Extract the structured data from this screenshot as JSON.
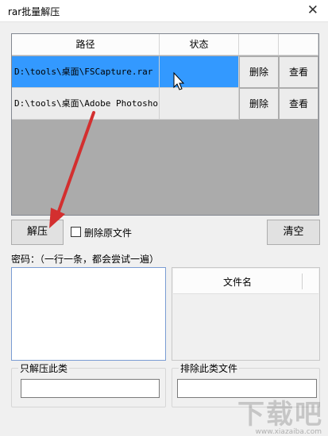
{
  "window": {
    "title": "rar批量解压",
    "close_glyph": "✕"
  },
  "grid": {
    "columns": [
      "路径",
      "状态",
      "",
      ""
    ],
    "rows": [
      {
        "path": "D:\\tools\\桌面\\FSCapture.rar",
        "status": "",
        "delete_label": "删除",
        "view_label": "查看",
        "selected": true
      },
      {
        "path": "D:\\tools\\桌面\\Adobe Photoshop",
        "status": "",
        "delete_label": "删除",
        "view_label": "查看",
        "selected": false
      }
    ]
  },
  "toolbar": {
    "extract_label": "解压",
    "delete_source_label": "删除原文件",
    "delete_source_checked": false,
    "clear_label": "清空"
  },
  "password": {
    "label": "密码：（一行一条，都会尝试一遍）",
    "value": ""
  },
  "filelist": {
    "header": "文件名"
  },
  "filters": {
    "only_extract_title": "只解压此类",
    "only_extract_value": "",
    "exclude_title": "排除此类文件",
    "exclude_value": ""
  },
  "watermark": {
    "text": "下载吧",
    "sub": "www.xiazaiba.com"
  },
  "colors": {
    "selection": "#3399ff",
    "arrow": "#d32f2f"
  }
}
